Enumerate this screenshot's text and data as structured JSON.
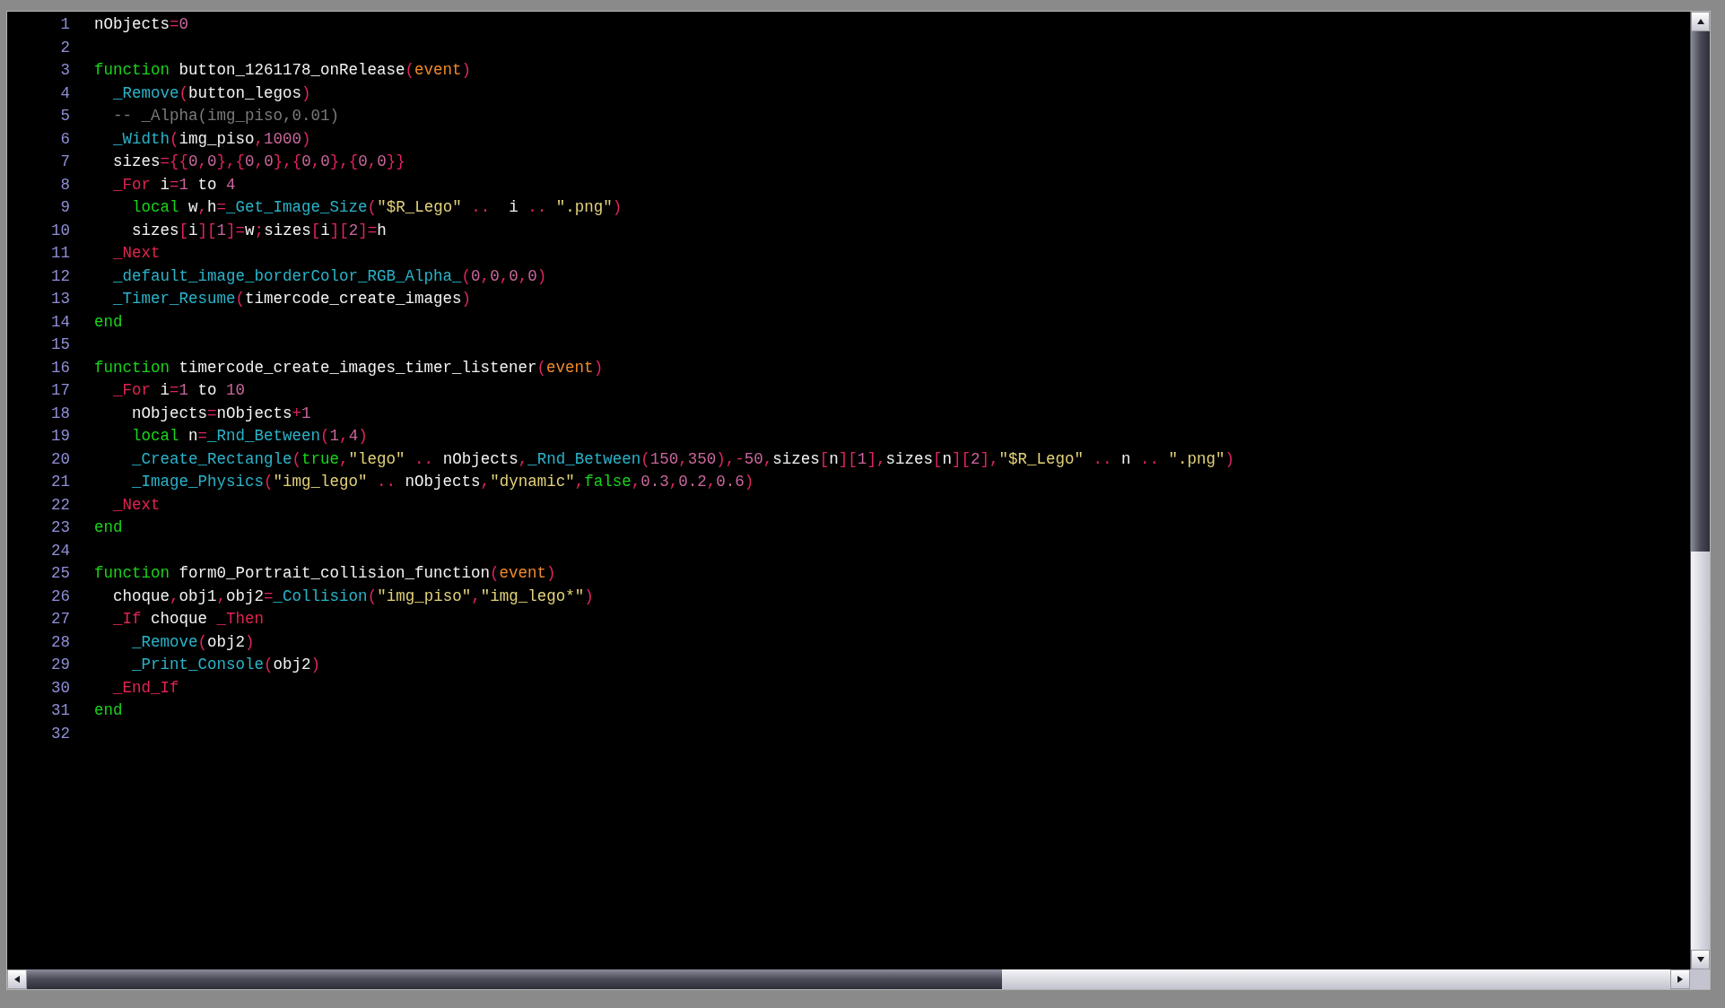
{
  "editor": {
    "lines": [
      {
        "number": "1",
        "tokens": [
          {
            "text": "nObjects",
            "kind": "plain"
          },
          {
            "text": "=",
            "kind": "punct"
          },
          {
            "text": "0",
            "kind": "number"
          }
        ]
      },
      {
        "number": "2"
      },
      {
        "number": "3",
        "tokens": [
          {
            "text": "function",
            "kind": "keyword"
          },
          {
            "text": " button_1261178_onRelease",
            "kind": "plain"
          },
          {
            "text": "(",
            "kind": "punct"
          },
          {
            "text": "event",
            "kind": "param"
          },
          {
            "text": ")",
            "kind": "punct"
          }
        ]
      },
      {
        "number": "4",
        "tokens": [
          {
            "text": "  _Remove",
            "kind": "func"
          },
          {
            "text": "(",
            "kind": "punct"
          },
          {
            "text": "button_legos",
            "kind": "plain"
          },
          {
            "text": ")",
            "kind": "punct"
          }
        ]
      },
      {
        "number": "5",
        "tokens": [
          {
            "text": "  -- _Alpha(img_piso,0.01)",
            "kind": "comment"
          }
        ]
      },
      {
        "number": "6",
        "tokens": [
          {
            "text": "  _Width",
            "kind": "func"
          },
          {
            "text": "(",
            "kind": "punct"
          },
          {
            "text": "img_piso",
            "kind": "plain"
          },
          {
            "text": ",",
            "kind": "punct"
          },
          {
            "text": "1000",
            "kind": "number"
          },
          {
            "text": ")",
            "kind": "punct"
          }
        ]
      },
      {
        "number": "7",
        "tokens": [
          {
            "text": "  sizes",
            "kind": "plain"
          },
          {
            "text": "={{",
            "kind": "punct"
          },
          {
            "text": "0",
            "kind": "number"
          },
          {
            "text": ",",
            "kind": "punct"
          },
          {
            "text": "0",
            "kind": "number"
          },
          {
            "text": "},{",
            "kind": "punct"
          },
          {
            "text": "0",
            "kind": "number"
          },
          {
            "text": ",",
            "kind": "punct"
          },
          {
            "text": "0",
            "kind": "number"
          },
          {
            "text": "},{",
            "kind": "punct"
          },
          {
            "text": "0",
            "kind": "number"
          },
          {
            "text": ",",
            "kind": "punct"
          },
          {
            "text": "0",
            "kind": "number"
          },
          {
            "text": "},{",
            "kind": "punct"
          },
          {
            "text": "0",
            "kind": "number"
          },
          {
            "text": ",",
            "kind": "punct"
          },
          {
            "text": "0",
            "kind": "number"
          },
          {
            "text": "}}",
            "kind": "punct"
          }
        ]
      },
      {
        "number": "8",
        "tokens": [
          {
            "text": "  _For",
            "kind": "flow"
          },
          {
            "text": " i",
            "kind": "plain"
          },
          {
            "text": "=",
            "kind": "punct"
          },
          {
            "text": "1",
            "kind": "number"
          },
          {
            "text": " to ",
            "kind": "plain"
          },
          {
            "text": "4",
            "kind": "number"
          }
        ]
      },
      {
        "number": "9",
        "tokens": [
          {
            "text": "    local",
            "kind": "keyword"
          },
          {
            "text": " w",
            "kind": "plain"
          },
          {
            "text": ",",
            "kind": "punct"
          },
          {
            "text": "h",
            "kind": "plain"
          },
          {
            "text": "=",
            "kind": "punct"
          },
          {
            "text": "_Get_Image_Size",
            "kind": "func"
          },
          {
            "text": "(",
            "kind": "punct"
          },
          {
            "text": "\"$R_Lego\"",
            "kind": "string"
          },
          {
            "text": " .. ",
            "kind": "punct"
          },
          {
            "text": " i ",
            "kind": "plain"
          },
          {
            "text": ".. ",
            "kind": "punct"
          },
          {
            "text": "\".png\"",
            "kind": "string"
          },
          {
            "text": ")",
            "kind": "punct"
          }
        ]
      },
      {
        "number": "10",
        "tokens": [
          {
            "text": "    sizes",
            "kind": "plain"
          },
          {
            "text": "[",
            "kind": "punct"
          },
          {
            "text": "i",
            "kind": "plain"
          },
          {
            "text": "][",
            "kind": "punct"
          },
          {
            "text": "1",
            "kind": "number"
          },
          {
            "text": "]=",
            "kind": "punct"
          },
          {
            "text": "w",
            "kind": "plain"
          },
          {
            "text": ";",
            "kind": "punct"
          },
          {
            "text": "sizes",
            "kind": "plain"
          },
          {
            "text": "[",
            "kind": "punct"
          },
          {
            "text": "i",
            "kind": "plain"
          },
          {
            "text": "][",
            "kind": "punct"
          },
          {
            "text": "2",
            "kind": "number"
          },
          {
            "text": "]=",
            "kind": "punct"
          },
          {
            "text": "h",
            "kind": "plain"
          }
        ]
      },
      {
        "number": "11",
        "tokens": [
          {
            "text": "  _Next",
            "kind": "flow"
          }
        ]
      },
      {
        "number": "12",
        "tokens": [
          {
            "text": "  _default_image_borderColor_RGB_Alpha_",
            "kind": "func"
          },
          {
            "text": "(",
            "kind": "punct"
          },
          {
            "text": "0",
            "kind": "number"
          },
          {
            "text": ",",
            "kind": "punct"
          },
          {
            "text": "0",
            "kind": "number"
          },
          {
            "text": ",",
            "kind": "punct"
          },
          {
            "text": "0",
            "kind": "number"
          },
          {
            "text": ",",
            "kind": "punct"
          },
          {
            "text": "0",
            "kind": "number"
          },
          {
            "text": ")",
            "kind": "punct"
          }
        ]
      },
      {
        "number": "13",
        "tokens": [
          {
            "text": "  _Timer_Resume",
            "kind": "func"
          },
          {
            "text": "(",
            "kind": "punct"
          },
          {
            "text": "timercode_create_images",
            "kind": "plain"
          },
          {
            "text": ")",
            "kind": "punct"
          }
        ]
      },
      {
        "number": "14",
        "tokens": [
          {
            "text": "end",
            "kind": "keyword"
          }
        ]
      },
      {
        "number": "15"
      },
      {
        "number": "16",
        "tokens": [
          {
            "text": "function",
            "kind": "keyword"
          },
          {
            "text": " timercode_create_images_timer_listener",
            "kind": "plain"
          },
          {
            "text": "(",
            "kind": "punct"
          },
          {
            "text": "event",
            "kind": "param"
          },
          {
            "text": ")",
            "kind": "punct"
          }
        ]
      },
      {
        "number": "17",
        "tokens": [
          {
            "text": "  _For",
            "kind": "flow"
          },
          {
            "text": " i",
            "kind": "plain"
          },
          {
            "text": "=",
            "kind": "punct"
          },
          {
            "text": "1",
            "kind": "number"
          },
          {
            "text": " to ",
            "kind": "plain"
          },
          {
            "text": "10",
            "kind": "number"
          }
        ]
      },
      {
        "number": "18",
        "tokens": [
          {
            "text": "    nObjects",
            "kind": "plain"
          },
          {
            "text": "=",
            "kind": "punct"
          },
          {
            "text": "nObjects",
            "kind": "plain"
          },
          {
            "text": "+",
            "kind": "punct"
          },
          {
            "text": "1",
            "kind": "number"
          }
        ]
      },
      {
        "number": "19",
        "tokens": [
          {
            "text": "    local",
            "kind": "keyword"
          },
          {
            "text": " n",
            "kind": "plain"
          },
          {
            "text": "=",
            "kind": "punct"
          },
          {
            "text": "_Rnd_Between",
            "kind": "func"
          },
          {
            "text": "(",
            "kind": "punct"
          },
          {
            "text": "1",
            "kind": "number"
          },
          {
            "text": ",",
            "kind": "punct"
          },
          {
            "text": "4",
            "kind": "number"
          },
          {
            "text": ")",
            "kind": "punct"
          }
        ]
      },
      {
        "number": "20",
        "tokens": [
          {
            "text": "    _Create_Rectangle",
            "kind": "func"
          },
          {
            "text": "(",
            "kind": "punct"
          },
          {
            "text": "true",
            "kind": "keyword"
          },
          {
            "text": ",",
            "kind": "punct"
          },
          {
            "text": "\"lego\"",
            "kind": "string"
          },
          {
            "text": " .. ",
            "kind": "punct"
          },
          {
            "text": "nObjects",
            "kind": "plain"
          },
          {
            "text": ",",
            "kind": "punct"
          },
          {
            "text": "_Rnd_Between",
            "kind": "func"
          },
          {
            "text": "(",
            "kind": "punct"
          },
          {
            "text": "150",
            "kind": "number"
          },
          {
            "text": ",",
            "kind": "punct"
          },
          {
            "text": "350",
            "kind": "number"
          },
          {
            "text": "),-",
            "kind": "punct"
          },
          {
            "text": "50",
            "kind": "number"
          },
          {
            "text": ",",
            "kind": "punct"
          },
          {
            "text": "sizes",
            "kind": "plain"
          },
          {
            "text": "[",
            "kind": "punct"
          },
          {
            "text": "n",
            "kind": "plain"
          },
          {
            "text": "][",
            "kind": "punct"
          },
          {
            "text": "1",
            "kind": "number"
          },
          {
            "text": "],",
            "kind": "punct"
          },
          {
            "text": "sizes",
            "kind": "plain"
          },
          {
            "text": "[",
            "kind": "punct"
          },
          {
            "text": "n",
            "kind": "plain"
          },
          {
            "text": "][",
            "kind": "punct"
          },
          {
            "text": "2",
            "kind": "number"
          },
          {
            "text": "],",
            "kind": "punct"
          },
          {
            "text": "\"$R_Lego\"",
            "kind": "string"
          },
          {
            "text": " .. ",
            "kind": "punct"
          },
          {
            "text": "n",
            "kind": "plain"
          },
          {
            "text": " .. ",
            "kind": "punct"
          },
          {
            "text": "\".png\"",
            "kind": "string"
          },
          {
            "text": ")",
            "kind": "punct"
          }
        ]
      },
      {
        "number": "21",
        "tokens": [
          {
            "text": "    _Image_Physics",
            "kind": "func"
          },
          {
            "text": "(",
            "kind": "punct"
          },
          {
            "text": "\"img_lego\"",
            "kind": "string"
          },
          {
            "text": " .. ",
            "kind": "punct"
          },
          {
            "text": "nObjects",
            "kind": "plain"
          },
          {
            "text": ",",
            "kind": "punct"
          },
          {
            "text": "\"dynamic\"",
            "kind": "string"
          },
          {
            "text": ",",
            "kind": "punct"
          },
          {
            "text": "false",
            "kind": "keyword"
          },
          {
            "text": ",",
            "kind": "punct"
          },
          {
            "text": "0.3",
            "kind": "number"
          },
          {
            "text": ",",
            "kind": "punct"
          },
          {
            "text": "0.2",
            "kind": "number"
          },
          {
            "text": ",",
            "kind": "punct"
          },
          {
            "text": "0.6",
            "kind": "number"
          },
          {
            "text": ")",
            "kind": "punct"
          }
        ]
      },
      {
        "number": "22",
        "tokens": [
          {
            "text": "  _Next",
            "kind": "flow"
          }
        ]
      },
      {
        "number": "23",
        "tokens": [
          {
            "text": "end",
            "kind": "keyword"
          }
        ]
      },
      {
        "number": "24"
      },
      {
        "number": "25",
        "tokens": [
          {
            "text": "function",
            "kind": "keyword"
          },
          {
            "text": " form0_Portrait_collision_function",
            "kind": "plain"
          },
          {
            "text": "(",
            "kind": "punct"
          },
          {
            "text": "event",
            "kind": "param"
          },
          {
            "text": ")",
            "kind": "punct"
          }
        ]
      },
      {
        "number": "26",
        "tokens": [
          {
            "text": "  choque",
            "kind": "plain"
          },
          {
            "text": ",",
            "kind": "punct"
          },
          {
            "text": "obj1",
            "kind": "plain"
          },
          {
            "text": ",",
            "kind": "punct"
          },
          {
            "text": "obj2",
            "kind": "plain"
          },
          {
            "text": "=",
            "kind": "punct"
          },
          {
            "text": "_Collision",
            "kind": "func"
          },
          {
            "text": "(",
            "kind": "punct"
          },
          {
            "text": "\"img_piso\"",
            "kind": "string"
          },
          {
            "text": ",",
            "kind": "punct"
          },
          {
            "text": "\"img_lego*\"",
            "kind": "string"
          },
          {
            "text": ")",
            "kind": "punct"
          }
        ]
      },
      {
        "number": "27",
        "tokens": [
          {
            "text": "  _If",
            "kind": "flow"
          },
          {
            "text": " choque ",
            "kind": "plain"
          },
          {
            "text": "_Then",
            "kind": "flow"
          }
        ]
      },
      {
        "number": "28",
        "tokens": [
          {
            "text": "    _Remove",
            "kind": "func"
          },
          {
            "text": "(",
            "kind": "punct"
          },
          {
            "text": "obj2",
            "kind": "plain"
          },
          {
            "text": ")",
            "kind": "punct"
          }
        ]
      },
      {
        "number": "29",
        "tokens": [
          {
            "text": "    _Print_Console",
            "kind": "func"
          },
          {
            "text": "(",
            "kind": "punct"
          },
          {
            "text": "obj2",
            "kind": "plain"
          },
          {
            "text": ")",
            "kind": "punct"
          }
        ]
      },
      {
        "number": "30",
        "tokens": [
          {
            "text": "  _End_If",
            "kind": "flow"
          }
        ]
      },
      {
        "number": "31",
        "tokens": [
          {
            "text": "end",
            "kind": "keyword"
          }
        ]
      },
      {
        "number": "32"
      }
    ]
  }
}
